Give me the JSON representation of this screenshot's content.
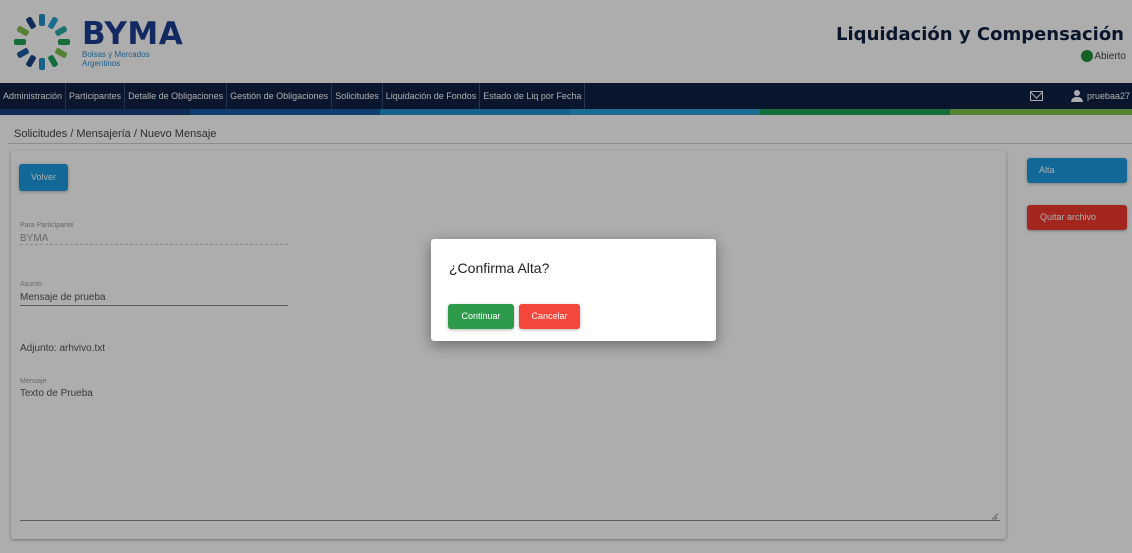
{
  "header": {
    "brand_name": "BYMA",
    "brand_sub_line1": "Bolsas y Mercados",
    "brand_sub_line2": "Argentinos",
    "app_title": "Liquidación y Compensación",
    "status_label": "Abierto",
    "status_color": "#1e8f34"
  },
  "nav": {
    "items": [
      {
        "label": "Administración"
      },
      {
        "label": "Participantes"
      },
      {
        "label": "Detalle de Obligaciones"
      },
      {
        "label": "Gestión de Obligaciones"
      },
      {
        "label": "Solicitudes"
      },
      {
        "label": "Liquidación de Fondos"
      },
      {
        "label": "Estado de Liq por Fecha"
      }
    ],
    "mail_icon": "mail-icon",
    "user_icon": "user-icon",
    "user_name": "pruebaa27"
  },
  "color_bar": [
    "#19407e",
    "#1a5aa3",
    "#1f8fc7",
    "#2a9fd6",
    "#29a9a0",
    "#1ea355",
    "#7cc04a"
  ],
  "breadcrumb": "Solicitudes / Mensajería / Nuevo Mensaje",
  "form": {
    "volver_label": "Volver",
    "para_label": "Para Participante",
    "para_value": "BYMA",
    "asunto_label": "Asunto",
    "asunto_value": "Mensaje de prueba",
    "adjunto_text": "Adjunto: arhvivo.txt",
    "mensaje_label": "Mensaje",
    "mensaje_value": "Texto de Prueba"
  },
  "actions": {
    "alta_label": "Alta",
    "quitar_label": "Quitar archivo"
  },
  "modal": {
    "title": "¿Confirma Alta?",
    "continuar_label": "Continuar",
    "cancelar_label": "Cancelar"
  },
  "colors": {
    "primary_blue": "#1b9be0",
    "danger_red": "#f23a2f",
    "success_green": "#2e9b4b",
    "nav_bg": "#0e2143",
    "brand_blue": "#1b3f8f"
  }
}
